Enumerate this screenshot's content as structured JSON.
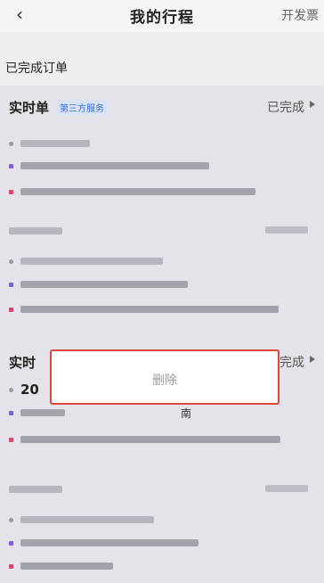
{
  "header": {
    "back_icon": "chevron-left-icon",
    "back_glyph": "‹",
    "title": "我的行程",
    "invoice_label": "开发票"
  },
  "section": {
    "title": "已完成订单"
  },
  "cards": [
    {
      "title": "实时单",
      "tag": "第三方服务",
      "status": "已完成",
      "rows": [
        "time",
        "start",
        "end"
      ]
    },
    {
      "rows": [
        "time",
        "start",
        "end"
      ]
    },
    {
      "title": "实时",
      "status": "完成",
      "rows": [
        "time",
        "start",
        "end"
      ],
      "time_prefix": "20",
      "start_suffix": "南"
    },
    {
      "rows": [
        "time",
        "start",
        "end"
      ]
    }
  ],
  "modal": {
    "delete_label": "删除"
  },
  "colors": {
    "accent": "#3a6fd8",
    "highlight": "#e0453c",
    "start_dot": "#7b61d1",
    "end_dot": "#d94773"
  }
}
